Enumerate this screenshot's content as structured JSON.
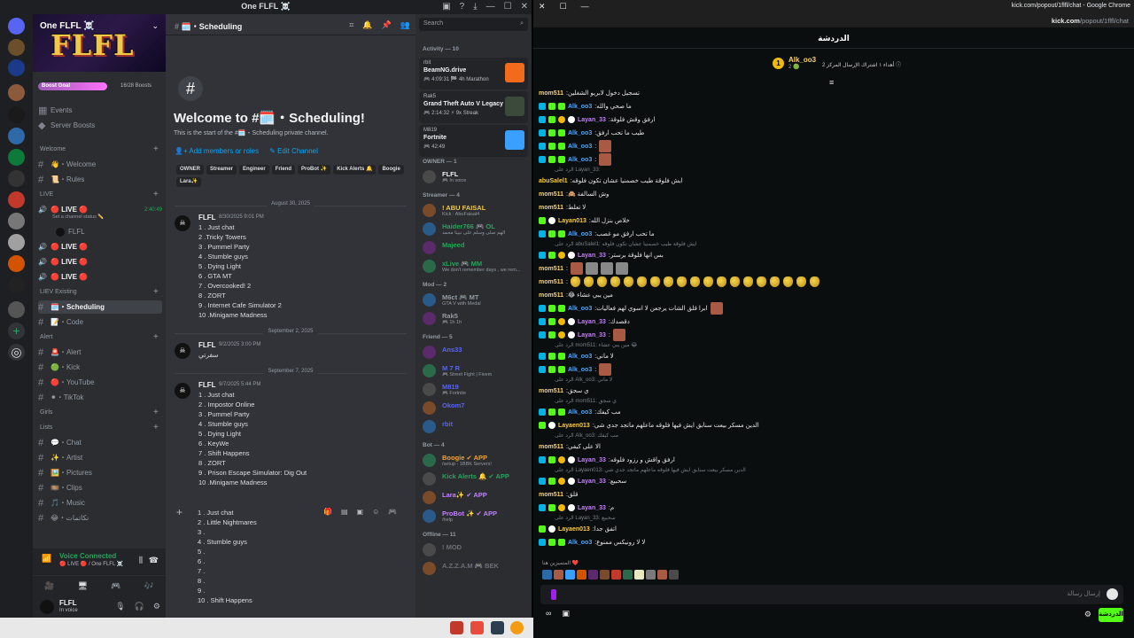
{
  "discord": {
    "window_title": "One FLFL ☠️",
    "server_name": "One FLFL ☠️",
    "banner_logo": "FLFL",
    "boost_goal_label": "Boost Goal",
    "boost_count": "16/28 Boosts",
    "nav": [
      "Events",
      "Server Boosts"
    ],
    "channels": [
      {
        "type": "cat",
        "label": "Welcome"
      },
      {
        "type": "ch",
        "label": "👋・Welcome"
      },
      {
        "type": "ch",
        "label": "📜・Rules"
      },
      {
        "type": "cat",
        "label": "LIVE"
      },
      {
        "type": "voice",
        "label": "🔴 LIVE 🔴",
        "time": "2:40:49",
        "status": "Set a channel status ✏️"
      },
      {
        "type": "sub",
        "label": "FLFL"
      },
      {
        "type": "voice",
        "label": "🔴 LIVE 🔴"
      },
      {
        "type": "voice",
        "label": "🔴 LIVE 🔴"
      },
      {
        "type": "voice",
        "label": "🔴 LIVE 🔴"
      },
      {
        "type": "cat",
        "label": "LIEV Existing"
      },
      {
        "type": "ch",
        "label": "🗓️・Scheduling",
        "selected": true
      },
      {
        "type": "ch",
        "label": "📝・Code"
      },
      {
        "type": "cat",
        "label": "Alert"
      },
      {
        "type": "ch",
        "label": "🚨・Alert"
      },
      {
        "type": "ch",
        "label": "🟢・Kick"
      },
      {
        "type": "ch",
        "label": "🔴・YouTube"
      },
      {
        "type": "ch",
        "label": "⚫・TikTok"
      },
      {
        "type": "cat",
        "label": "Girls"
      },
      {
        "type": "cat",
        "label": "Lists"
      },
      {
        "type": "ch",
        "label": "💬・Chat"
      },
      {
        "type": "ch",
        "label": "✨・Artist"
      },
      {
        "type": "ch",
        "label": "🖼️・Pictures"
      },
      {
        "type": "ch",
        "label": "🎞️・Clips"
      },
      {
        "type": "ch",
        "label": "🎵・Music"
      },
      {
        "type": "ch",
        "label": "😂・نكاتمات"
      }
    ],
    "voice_connected": "Voice Connected",
    "voice_channel": "🔴 LIVE 🔴 / One FLFL ☠️",
    "user": {
      "name": "FLFL",
      "status": "In voice"
    },
    "channel_header": "🗓️・Scheduling",
    "welcome_title": "Welcome to #🗓️・Scheduling!",
    "welcome_sub": "This is the start of the #🗓️・Scheduling private channel.",
    "action_add": "Add members or roles",
    "action_edit": "Edit Channel",
    "roles": [
      "OWNER",
      "Streamer",
      "Engineer",
      "Friend",
      "ProBot ✨",
      "Kick Alerts 🔔",
      "Boogie",
      "Lara✨"
    ],
    "messages": [
      {
        "date": "August 30, 2025",
        "author": "FLFL",
        "time": "8/30/2025 9:01 PM",
        "lines": [
          "1 . Just chat",
          "2 .Tricky Towers",
          "3 . Pummel Party",
          "4 . Stumble guys",
          "5 . Dying Light",
          "6 . GTA MT",
          "7 . Overcooked! 2",
          "8 . ZORT",
          "9 . Internet Cafe Simulator 2",
          "10 .Minigame Madness"
        ]
      },
      {
        "date": "September 2, 2025",
        "author": "FLFL",
        "time": "9/2/2025 3:00 PM",
        "lines": [
          "سفرتي"
        ]
      },
      {
        "date": "September 7, 2025",
        "author": "FLFL",
        "time": "9/7/2025 5:44 PM",
        "lines": [
          "1 . Just chat",
          "2 . Impostor Online",
          "3 . Pummel Party",
          "4 . Stumble guys",
          "5 . Dying Light",
          "6 . KeyWe",
          "7 . Shift Happens",
          "8 . ZORT",
          "9 . Prison Escape Simulator: Dig Out",
          "10 .Minigame Madness"
        ]
      }
    ],
    "composer_lines": [
      "1 . Just chat",
      "2 . Little Nightmares",
      "3 .",
      "4 . Stumble guys",
      "5 .",
      "6 .",
      "7 .",
      "8 .",
      "9 .",
      "10 . Shift Happens"
    ],
    "search_placeholder": "Search",
    "activity_label": "Activity — 10",
    "activities": [
      {
        "user": "rbit",
        "game": "BeamNG.drive",
        "detail": "🎮 4:09:31  🏁 4h Marathon",
        "color": "#f26b1d"
      },
      {
        "user": "Rak5",
        "game": "Grand Theft Auto V Legacy",
        "detail": "🎮 2:14:32  ⚡ 9x Streak",
        "color": "#3b4a3a"
      },
      {
        "user": "M819",
        "game": "Fortnite",
        "detail": "🎮 42:49",
        "color": "#3aa0ff"
      }
    ],
    "member_sections": [
      {
        "label": "OWNER — 1",
        "members": [
          {
            "name": "FLFL",
            "sub": "🎮 In voice",
            "color": "#f2f3f5"
          }
        ]
      },
      {
        "label": "Streamer — 4",
        "members": [
          {
            "name": "! ABU FAISAL",
            "sub": "Kick : AbuFaisal4",
            "color": "#f0c84a"
          },
          {
            "name": "Haider766 🎮 OL",
            "sub": "الهم صلى وسلم على نبينا محمد",
            "color": "#23a55a"
          },
          {
            "name": "Majeed",
            "sub": "",
            "color": "#23a55a"
          },
          {
            "name": "xLive 🎮 MM",
            "sub": "We don't remember days , we rem...",
            "color": "#23a55a"
          }
        ]
      },
      {
        "label": "Mod — 2",
        "members": [
          {
            "name": "M6ct 🎮 MT",
            "sub": "GTA V with Medal",
            "color": "#949ba4"
          },
          {
            "name": "Rak5",
            "sub": "🎮 1h 1h",
            "color": "#949ba4"
          }
        ]
      },
      {
        "label": "Friend — 5",
        "members": [
          {
            "name": "Ans33",
            "sub": "",
            "color": "#5865f2"
          },
          {
            "name": "M 7 R",
            "sub": "🎮 Street Fight | Fivem",
            "color": "#5865f2"
          },
          {
            "name": "M819",
            "sub": "🎮 Fortnite",
            "color": "#5865f2"
          },
          {
            "name": "Okom7",
            "sub": "",
            "color": "#5865f2"
          },
          {
            "name": "rbit",
            "sub": "",
            "color": "#5865f2"
          }
        ]
      },
      {
        "label": "Bot — 4",
        "members": [
          {
            "name": "Boogie ✔ APP",
            "sub": "/setup - 1BBK Servers!",
            "color": "#f0a030"
          },
          {
            "name": "Kick Alerts 🔔 ✔ APP",
            "sub": "",
            "color": "#23a55a"
          },
          {
            "name": "Lara✨ ✔ APP",
            "sub": "",
            "color": "#c080ff"
          },
          {
            "name": "ProBot ✨ ✔ APP",
            "sub": "/help",
            "color": "#c080ff"
          }
        ]
      },
      {
        "label": "Offline — 11",
        "members": [
          {
            "name": "! MOD",
            "sub": "",
            "color": "#6d6f78"
          },
          {
            "name": "A.Z.Z.A.M 🎮 BEK",
            "sub": "",
            "color": "#6d6f78"
          }
        ]
      }
    ]
  },
  "kick": {
    "window_title": "kick.com/popout/1flfl/chat - Google Chrome",
    "url_host": "kick.com",
    "url_path": "/popout/1flfl/chat",
    "chat_header": "الدردشة",
    "pinned_user": "Alk_oo3",
    "pinned_count": "2 🟢",
    "pinned_text": "أهداء ١ اشتراك الإرسال المركز 2 ⓘ",
    "input_placeholder": "إرسال رسالة",
    "chat_button": "الدردشة",
    "colors": {
      "accent": "#53fc18",
      "mom511": "#ffd166",
      "alk": "#4ea6ff",
      "layan": "#c77dff",
      "layaen": "#ffcc33"
    },
    "messages": [
      {
        "user": "mom511",
        "c": "mom511",
        "text": ":تسجيل دخول لابريو الشغلين",
        "badges": []
      },
      {
        "user": "Alk_oo3",
        "c": "alk",
        "text": ":ما صحي والله",
        "badges": [
          "b1",
          "b2",
          "b2"
        ]
      },
      {
        "user": "Layan_33",
        "c": "layan",
        "text": ":ارفق وقش فلوقة",
        "badges": [
          "b1",
          "b2",
          "b3",
          "b4"
        ]
      },
      {
        "user": "Alk_oo3",
        "c": "alk",
        "text": ":طيب ما تحب ارفق",
        "badges": [
          "b1",
          "b2",
          "b2"
        ]
      },
      {
        "user": "Alk_oo3",
        "c": "alk",
        "text": ":",
        "badges": [
          "b1",
          "b2",
          "b2"
        ],
        "emote": true
      },
      {
        "user": "Alk_oo3",
        "c": "alk",
        "text": ":",
        "badges": [
          "b1",
          "b2",
          "b2"
        ],
        "emote": true
      },
      {
        "reply": "الرد على Layan_33:",
        "user": "abuSalel1",
        "c": "layaen",
        "text": ":ايش فلوقة طيب خصمنيا عشان تكون فلوقه",
        "badges": []
      },
      {
        "user": "mom511",
        "c": "mom511",
        "text": ":🙈 وش السالفة",
        "badges": []
      },
      {
        "user": "mom511",
        "c": "mom511",
        "text": ":لا تعلط",
        "badges": []
      },
      {
        "user": "Layan013",
        "c": "layaen",
        "text": ":خلاص بنزل الله",
        "badges": [
          "b2",
          "b4"
        ]
      },
      {
        "user": "Alk_oo3",
        "c": "alk",
        "text": ":ما تحب ارفق مو غصب",
        "badges": [
          "b1",
          "b2",
          "b2"
        ]
      },
      {
        "reply": "الرد على abuSalel1: ايش فلوقة طيب خصمنيا عشان تكون فلوقه",
        "user": "Layan_33",
        "c": "layan",
        "text": ":بس انها فلوقة برستر",
        "badges": [
          "b1",
          "b2",
          "b3",
          "b4"
        ]
      },
      {
        "user": "mom511",
        "c": "mom511",
        "text": ":",
        "badges": [],
        "emote": true
      },
      {
        "user": "mom511",
        "c": "mom511",
        "text": ":",
        "badges": [],
        "corn": 19
      },
      {
        "user": "mom511",
        "c": "mom511",
        "text": ":😂 مين يبي عشاء",
        "badges": []
      },
      {
        "user": "Alk_oo3",
        "c": "alk",
        "text": ":ابرا قلق الشات يرجعن لا اسوي لهم فعاليات",
        "badges": [
          "b1",
          "b2",
          "b2"
        ],
        "emote_after": true
      },
      {
        "user": "Layan_33",
        "c": "layan",
        "text": ":دقصدك",
        "badges": [
          "b1",
          "b2",
          "b3",
          "b4"
        ]
      },
      {
        "user": "Layan_33",
        "c": "layan",
        "text": ":",
        "badges": [
          "b1",
          "b2",
          "b3",
          "b4"
        ],
        "emote": true
      },
      {
        "reply": "الرد على mom511: مين يبي عشاء 😂",
        "user": "Alk_oo3",
        "c": "alk",
        "text": ":لا ماني",
        "badges": [
          "b1",
          "b2",
          "b2"
        ]
      },
      {
        "user": "Alk_oo3",
        "c": "alk",
        "text": ":",
        "badges": [
          "b1",
          "b2",
          "b2"
        ],
        "emote": true
      },
      {
        "reply": "الرد على Alk_oo3: لا ماني",
        "user": "mom511",
        "c": "mom511",
        "text": ":ي سجق",
        "badges": []
      },
      {
        "reply": "الرد على mom511: ي سجق",
        "user": "Alk_oo3",
        "c": "alk",
        "text": ":مب كيفك",
        "badges": [
          "b1",
          "b2",
          "b2"
        ]
      },
      {
        "user": "Layaen013",
        "c": "layaen",
        "text": ":الدين مسكر بيعت سنابق ايش فيها فلوقه ماعلهم ماتجد جدي شي",
        "badges": [
          "b2",
          "b4"
        ]
      },
      {
        "reply": "الرد على Alk_oo3: مب كيفك",
        "user": "mom511",
        "c": "mom511",
        "text": ":الا على كيفي",
        "badges": []
      },
      {
        "user": "Layan_33",
        "c": "layan",
        "text": ":ارفق واقش و رزود فلوقه",
        "badges": [
          "b1",
          "b2",
          "b3",
          "b4"
        ]
      },
      {
        "reply": "الرد على Layaen013: الدين مسكر بيعت سنابق ايش فيها فلوقه ماعلهم ماتجد جدي شي",
        "user": "Layan_33",
        "c": "layan",
        "text": ":سحبيع",
        "badges": [
          "b1",
          "b2",
          "b3",
          "b4"
        ]
      },
      {
        "user": "mom511",
        "c": "mom511",
        "text": ":قلق",
        "badges": []
      },
      {
        "user": "Layan_33",
        "c": "layan",
        "text": ":م",
        "badges": [
          "b1",
          "b2",
          "b3",
          "b4"
        ]
      },
      {
        "reply": "الرد على Layan_33: سحبيع",
        "user": "Layaen013",
        "c": "layaen",
        "text": ":اتفق جدا",
        "badges": [
          "b2",
          "b4"
        ]
      },
      {
        "user": "Alk_oo3",
        "c": "alk",
        "text": ":لا لا رونيكس ممنوع",
        "badges": [
          "b1",
          "b2",
          "b2"
        ]
      }
    ],
    "supporters_label": "المتميزين هنا ❤️"
  }
}
